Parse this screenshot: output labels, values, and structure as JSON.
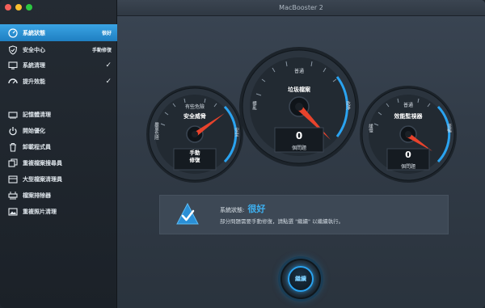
{
  "window": {
    "title": "MacBooster 2"
  },
  "sidebar": {
    "primary": [
      {
        "label": "系統狀態",
        "status": "很好",
        "icon": "gauge-icon",
        "active": true
      },
      {
        "label": "安全中心",
        "status": "手動修復",
        "icon": "shield-icon"
      },
      {
        "label": "系統清理",
        "status": "✓",
        "icon": "monitor-icon"
      },
      {
        "label": "提升效能",
        "status": "✓",
        "icon": "speedometer-icon"
      }
    ],
    "tools": [
      {
        "label": "記憶體清理",
        "icon": "memory-icon"
      },
      {
        "label": "開始優化",
        "icon": "power-icon"
      },
      {
        "label": "卸載程式員",
        "icon": "trash-icon"
      },
      {
        "label": "重複檔案搜尋員",
        "icon": "duplicate-icon"
      },
      {
        "label": "大型檔案清理員",
        "icon": "large-file-icon"
      },
      {
        "label": "檔案排除器",
        "icon": "shredder-icon"
      },
      {
        "label": "重複照片清理",
        "icon": "photo-icon"
      }
    ]
  },
  "gauges": {
    "security": {
      "title": "安全威脅",
      "top": "有些危險",
      "left": "嚴重危險",
      "right": "安全",
      "box": "手動\n修復",
      "box_l1": "手動",
      "box_l2": "修復"
    },
    "junk": {
      "title": "垃圾檔案",
      "top": "普通",
      "left": "髒亂",
      "right": "乾淨",
      "value": "0",
      "unit": "個問題"
    },
    "perf": {
      "title": "效能監視器",
      "top": "普通",
      "left": "緩慢",
      "right": "流暢",
      "value": "0",
      "unit": "個問題"
    }
  },
  "status_panel": {
    "label": "系統狀態:",
    "value": "很好",
    "message": "部分問題需要手動修復，請點選 \"繼續\" 以繼續執行。"
  },
  "continue_button": {
    "label": "繼續"
  },
  "colors": {
    "accent": "#2aa3f0",
    "needle": "#e8432c",
    "active": "#2a8fd6"
  }
}
